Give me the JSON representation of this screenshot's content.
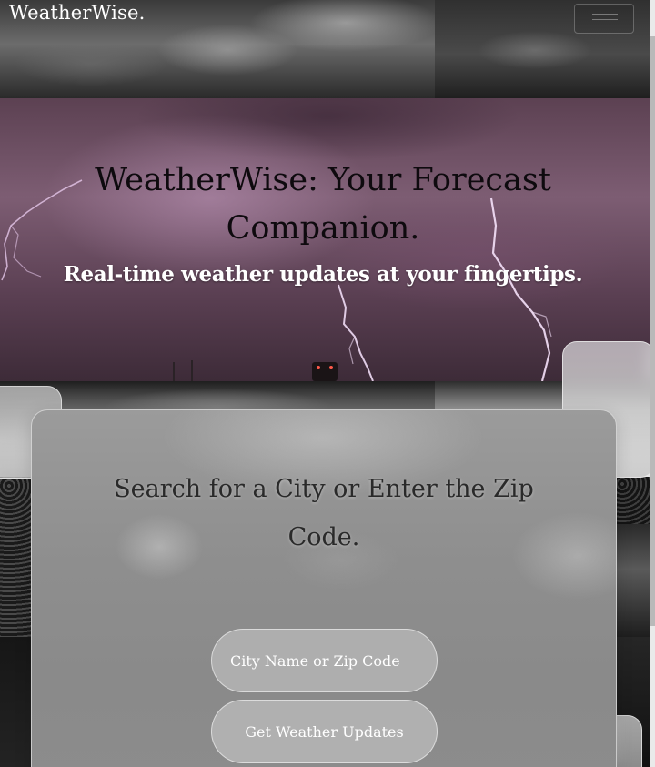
{
  "nav": {
    "brand": "WeatherWise.",
    "menu_icon": "hamburger-menu-icon"
  },
  "hero": {
    "title": "WeatherWise: Your Forecast Companion.",
    "subtitle": "Real-time weather updates at your fingertips."
  },
  "search": {
    "heading": "Search for a City or Enter the Zip Code.",
    "input_placeholder": "City Name or Zip Code",
    "input_value": "",
    "button_label": "Get Weather Updates"
  },
  "colors": {
    "hero_tint": "#6e5066",
    "card_glass": "#8e8e8e",
    "text_light": "#ffffff",
    "title_dark": "#0e0a0e"
  }
}
